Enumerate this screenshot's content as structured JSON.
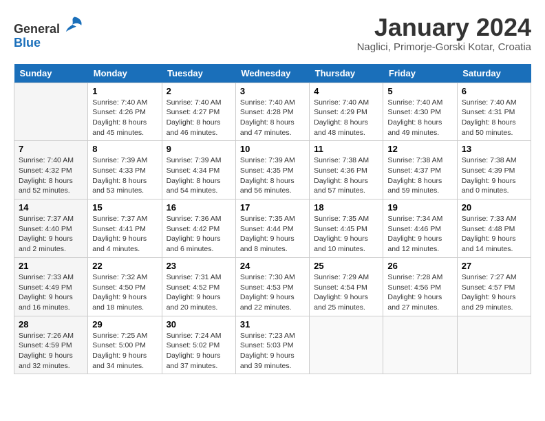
{
  "header": {
    "logo_general": "General",
    "logo_blue": "Blue",
    "title": "January 2024",
    "subtitle": "Naglici, Primorje-Gorski Kotar, Croatia"
  },
  "calendar": {
    "days_of_week": [
      "Sunday",
      "Monday",
      "Tuesday",
      "Wednesday",
      "Thursday",
      "Friday",
      "Saturday"
    ],
    "weeks": [
      [
        {
          "day": "",
          "info": ""
        },
        {
          "day": "1",
          "info": "Sunrise: 7:40 AM\nSunset: 4:26 PM\nDaylight: 8 hours\nand 45 minutes."
        },
        {
          "day": "2",
          "info": "Sunrise: 7:40 AM\nSunset: 4:27 PM\nDaylight: 8 hours\nand 46 minutes."
        },
        {
          "day": "3",
          "info": "Sunrise: 7:40 AM\nSunset: 4:28 PM\nDaylight: 8 hours\nand 47 minutes."
        },
        {
          "day": "4",
          "info": "Sunrise: 7:40 AM\nSunset: 4:29 PM\nDaylight: 8 hours\nand 48 minutes."
        },
        {
          "day": "5",
          "info": "Sunrise: 7:40 AM\nSunset: 4:30 PM\nDaylight: 8 hours\nand 49 minutes."
        },
        {
          "day": "6",
          "info": "Sunrise: 7:40 AM\nSunset: 4:31 PM\nDaylight: 8 hours\nand 50 minutes."
        }
      ],
      [
        {
          "day": "7",
          "info": "Sunrise: 7:40 AM\nSunset: 4:32 PM\nDaylight: 8 hours\nand 52 minutes."
        },
        {
          "day": "8",
          "info": "Sunrise: 7:39 AM\nSunset: 4:33 PM\nDaylight: 8 hours\nand 53 minutes."
        },
        {
          "day": "9",
          "info": "Sunrise: 7:39 AM\nSunset: 4:34 PM\nDaylight: 8 hours\nand 54 minutes."
        },
        {
          "day": "10",
          "info": "Sunrise: 7:39 AM\nSunset: 4:35 PM\nDaylight: 8 hours\nand 56 minutes."
        },
        {
          "day": "11",
          "info": "Sunrise: 7:38 AM\nSunset: 4:36 PM\nDaylight: 8 hours\nand 57 minutes."
        },
        {
          "day": "12",
          "info": "Sunrise: 7:38 AM\nSunset: 4:37 PM\nDaylight: 8 hours\nand 59 minutes."
        },
        {
          "day": "13",
          "info": "Sunrise: 7:38 AM\nSunset: 4:39 PM\nDaylight: 9 hours\nand 0 minutes."
        }
      ],
      [
        {
          "day": "14",
          "info": "Sunrise: 7:37 AM\nSunset: 4:40 PM\nDaylight: 9 hours\nand 2 minutes."
        },
        {
          "day": "15",
          "info": "Sunrise: 7:37 AM\nSunset: 4:41 PM\nDaylight: 9 hours\nand 4 minutes."
        },
        {
          "day": "16",
          "info": "Sunrise: 7:36 AM\nSunset: 4:42 PM\nDaylight: 9 hours\nand 6 minutes."
        },
        {
          "day": "17",
          "info": "Sunrise: 7:35 AM\nSunset: 4:44 PM\nDaylight: 9 hours\nand 8 minutes."
        },
        {
          "day": "18",
          "info": "Sunrise: 7:35 AM\nSunset: 4:45 PM\nDaylight: 9 hours\nand 10 minutes."
        },
        {
          "day": "19",
          "info": "Sunrise: 7:34 AM\nSunset: 4:46 PM\nDaylight: 9 hours\nand 12 minutes."
        },
        {
          "day": "20",
          "info": "Sunrise: 7:33 AM\nSunset: 4:48 PM\nDaylight: 9 hours\nand 14 minutes."
        }
      ],
      [
        {
          "day": "21",
          "info": "Sunrise: 7:33 AM\nSunset: 4:49 PM\nDaylight: 9 hours\nand 16 minutes."
        },
        {
          "day": "22",
          "info": "Sunrise: 7:32 AM\nSunset: 4:50 PM\nDaylight: 9 hours\nand 18 minutes."
        },
        {
          "day": "23",
          "info": "Sunrise: 7:31 AM\nSunset: 4:52 PM\nDaylight: 9 hours\nand 20 minutes."
        },
        {
          "day": "24",
          "info": "Sunrise: 7:30 AM\nSunset: 4:53 PM\nDaylight: 9 hours\nand 22 minutes."
        },
        {
          "day": "25",
          "info": "Sunrise: 7:29 AM\nSunset: 4:54 PM\nDaylight: 9 hours\nand 25 minutes."
        },
        {
          "day": "26",
          "info": "Sunrise: 7:28 AM\nSunset: 4:56 PM\nDaylight: 9 hours\nand 27 minutes."
        },
        {
          "day": "27",
          "info": "Sunrise: 7:27 AM\nSunset: 4:57 PM\nDaylight: 9 hours\nand 29 minutes."
        }
      ],
      [
        {
          "day": "28",
          "info": "Sunrise: 7:26 AM\nSunset: 4:59 PM\nDaylight: 9 hours\nand 32 minutes."
        },
        {
          "day": "29",
          "info": "Sunrise: 7:25 AM\nSunset: 5:00 PM\nDaylight: 9 hours\nand 34 minutes."
        },
        {
          "day": "30",
          "info": "Sunrise: 7:24 AM\nSunset: 5:02 PM\nDaylight: 9 hours\nand 37 minutes."
        },
        {
          "day": "31",
          "info": "Sunrise: 7:23 AM\nSunset: 5:03 PM\nDaylight: 9 hours\nand 39 minutes."
        },
        {
          "day": "",
          "info": ""
        },
        {
          "day": "",
          "info": ""
        },
        {
          "day": "",
          "info": ""
        }
      ]
    ]
  }
}
